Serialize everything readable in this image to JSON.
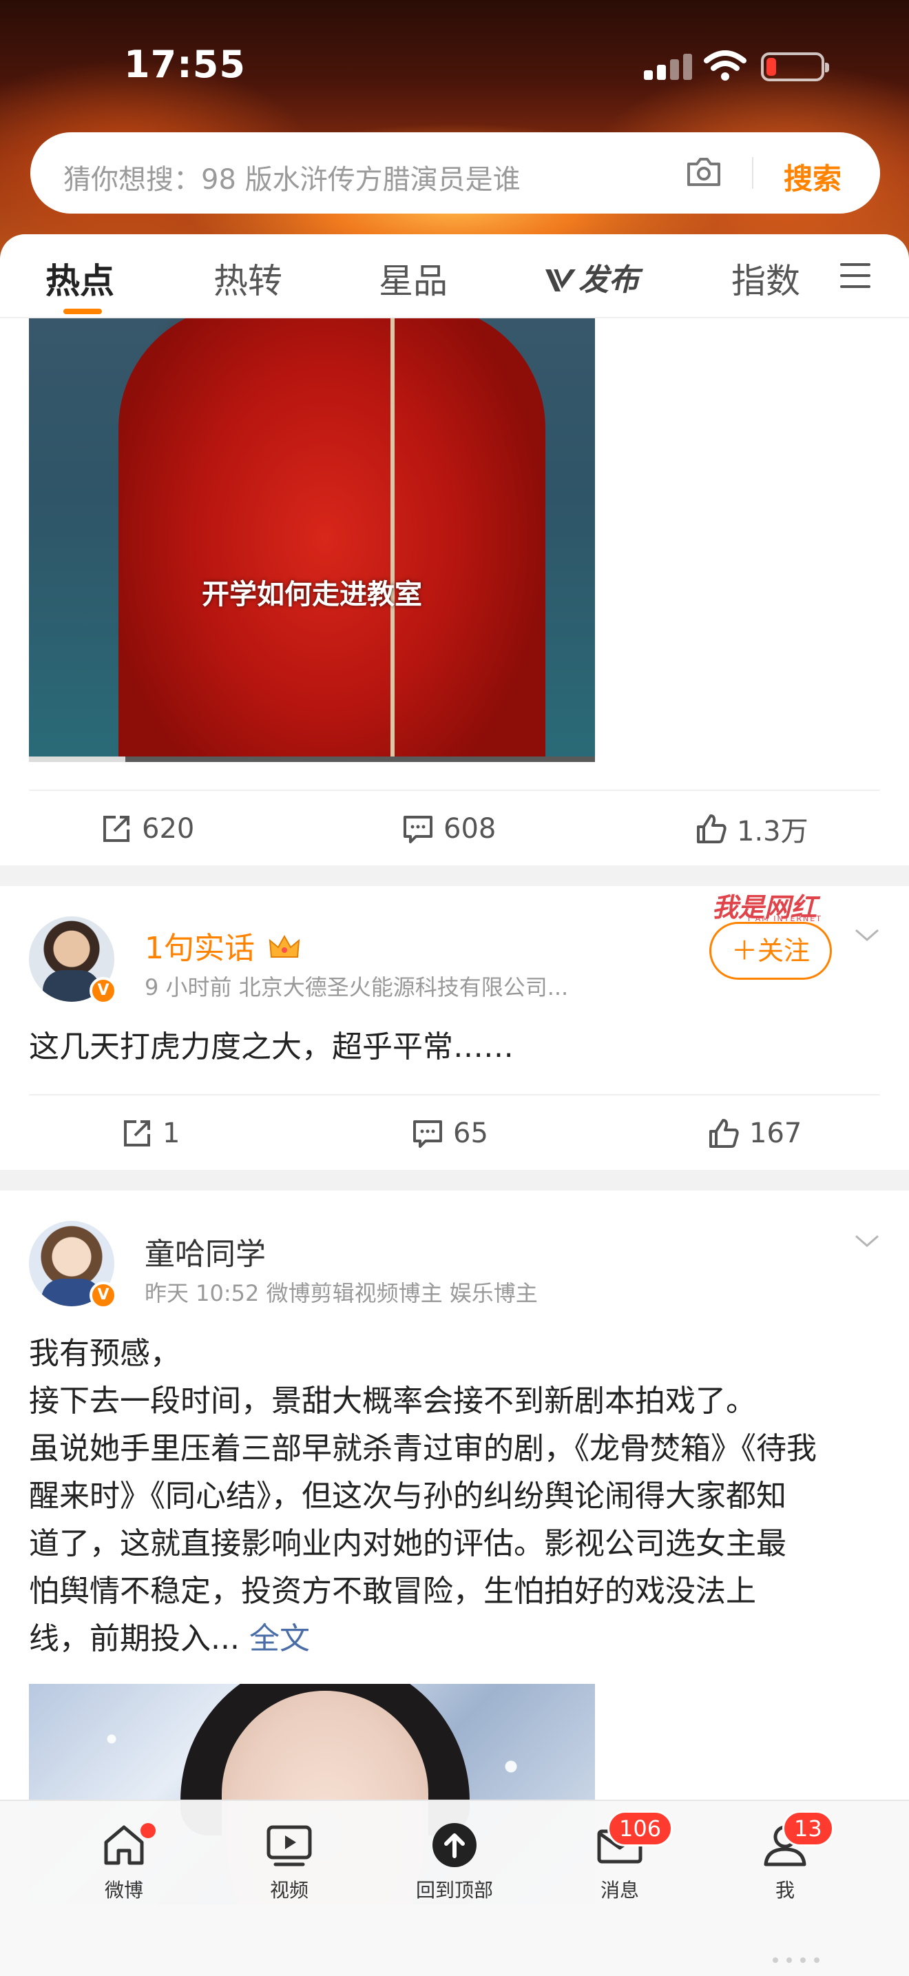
{
  "status_bar": {
    "time": "17:55"
  },
  "search": {
    "placeholder": "猜你想搜：98 版水浒传方腊演员是谁",
    "button_label": "搜索"
  },
  "tabs": [
    {
      "label": "热点",
      "active": true
    },
    {
      "label": "热转"
    },
    {
      "label": "星品"
    },
    {
      "label": "发布",
      "icon": "v-logo-icon"
    },
    {
      "label": "指数"
    }
  ],
  "post1": {
    "video_caption": "开学如何走进教室",
    "video_progress": 0.17,
    "reposts": "620",
    "comments": "608",
    "likes": "1.3万"
  },
  "post2": {
    "username": "1句实话",
    "meta": "9 小时前  北京大德圣火能源科技有限公司...",
    "follow_label": "＋关注",
    "watermark": "我是网红",
    "watermark_sub": "I AM INTERNET",
    "text": "这几天打虎力度之大，超乎平常……",
    "reposts": "1",
    "comments": "65",
    "likes": "167"
  },
  "post3": {
    "username": "童哈同学",
    "meta": "昨天 10:52  微博剪辑视频博主 娱乐博主",
    "lines": [
      "我有预感，",
      "接下去一段时间，景甜大概率会接不到新剧本拍戏了。",
      "虽说她手里压着三部早就杀青过审的剧，《龙骨焚箱》《待我",
      "醒来时》《同心结》，但这次与孙的纠纷舆论闹得大家都知",
      "道了，这就直接影响业内对她的评估。影视公司选女主最",
      "怕舆情不稳定，投资方不敢冒险，生怕拍好的戏没法上",
      "线，前期投入..."
    ],
    "full_text_link": "全文"
  },
  "bottom_nav": [
    {
      "label": "微博",
      "icon": "home-icon",
      "dot": true
    },
    {
      "label": "视频",
      "icon": "video-icon"
    },
    {
      "label": "回到顶部",
      "icon": "back-to-top-icon"
    },
    {
      "label": "消息",
      "icon": "message-icon",
      "badge": "106"
    },
    {
      "label": "我",
      "icon": "profile-icon",
      "badge": "13"
    }
  ],
  "colors": {
    "accent": "#ff8200",
    "badge": "#ff3b30",
    "link": "#4a6da7"
  }
}
